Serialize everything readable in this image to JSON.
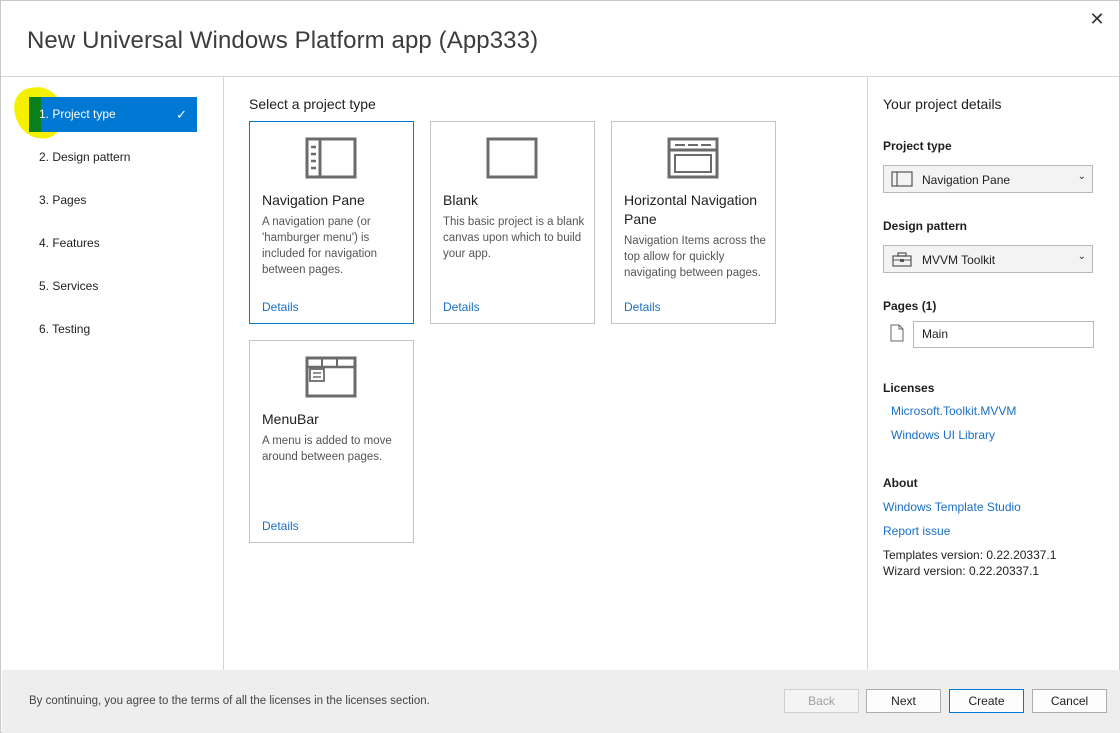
{
  "window": {
    "title": "New Universal Windows Platform app (App333)",
    "close_glyph": "✕"
  },
  "nav": {
    "items": [
      {
        "label": "1. Project type",
        "active": true
      },
      {
        "label": "2. Design pattern"
      },
      {
        "label": "3. Pages"
      },
      {
        "label": "4. Features"
      },
      {
        "label": "5. Services"
      },
      {
        "label": "6. Testing"
      }
    ],
    "check_glyph": "✓",
    "accent": "#0078d4"
  },
  "main": {
    "heading": "Select a project type",
    "cards": [
      {
        "title": "Navigation Pane",
        "description": "A navigation pane (or 'hamburger menu') is included for navigation between pages.",
        "details": "Details",
        "icon": "navigation-pane-icon",
        "selected": true
      },
      {
        "title": "Blank",
        "description": "This basic project is a blank canvas upon which to build your app.",
        "details": "Details",
        "icon": "blank-icon"
      },
      {
        "title": "Horizontal Navigation Pane",
        "description": "Navigation Items across the top allow for quickly navigating between pages.",
        "details": "Details",
        "icon": "horizontal-navigation-icon"
      },
      {
        "title": "MenuBar",
        "description": "A menu is added to move around between pages.",
        "details": "Details",
        "icon": "menubar-icon"
      }
    ]
  },
  "details_panel": {
    "title": "Your project details",
    "project_type_label": "Project type",
    "project_type_value": "Navigation Pane",
    "design_pattern_label": "Design pattern",
    "design_pattern_value": "MVVM Toolkit",
    "pages_label": "Pages (1)",
    "page_name": "Main",
    "licenses_label": "Licenses",
    "licenses": [
      "Microsoft.Toolkit.MVVM",
      "Windows UI Library"
    ],
    "about_label": "About",
    "about_links": [
      "Windows Template Studio",
      "Report issue"
    ],
    "templates_version": "Templates version: 0.22.20337.1",
    "wizard_version": "Wizard version: 0.22.20337.1",
    "chevron_glyph": "⌄"
  },
  "footer": {
    "notice": "By continuing, you agree to the terms of all the licenses in the licenses section.",
    "back": "Back",
    "next": "Next",
    "create": "Create",
    "cancel": "Cancel"
  }
}
